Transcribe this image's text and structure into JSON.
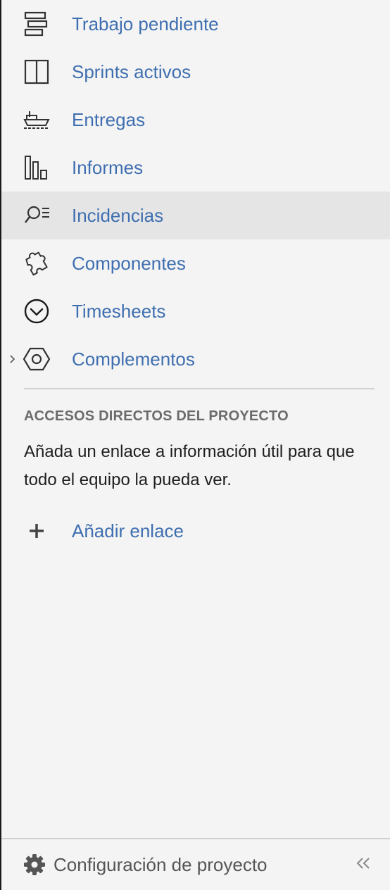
{
  "nav": {
    "items": [
      {
        "label": "Trabajo pendiente",
        "icon": "backlog-icon",
        "active": false
      },
      {
        "label": "Sprints activos",
        "icon": "board-icon",
        "active": false
      },
      {
        "label": "Entregas",
        "icon": "ship-icon",
        "active": false
      },
      {
        "label": "Informes",
        "icon": "reports-icon",
        "active": false
      },
      {
        "label": "Incidencias",
        "icon": "search-issues-icon",
        "active": true
      },
      {
        "label": "Componentes",
        "icon": "puzzle-icon",
        "active": false
      },
      {
        "label": "Timesheets",
        "icon": "clock-icon",
        "active": false
      },
      {
        "label": "Complementos",
        "icon": "hexagon-icon",
        "active": false
      }
    ]
  },
  "shortcuts": {
    "heading": "ACCESOS DIRECTOS DEL PROYECTO",
    "description": "Añada un enlace a información útil para que todo el equipo la pueda ver.",
    "add_label": "Añadir enlace"
  },
  "footer": {
    "settings_label": "Configuración de proyecto",
    "collapse_glyph": "«"
  },
  "colors": {
    "link": "#3f6fb0",
    "active_background": "#e5e5e5",
    "sidebar_background": "#f4f4f4"
  }
}
